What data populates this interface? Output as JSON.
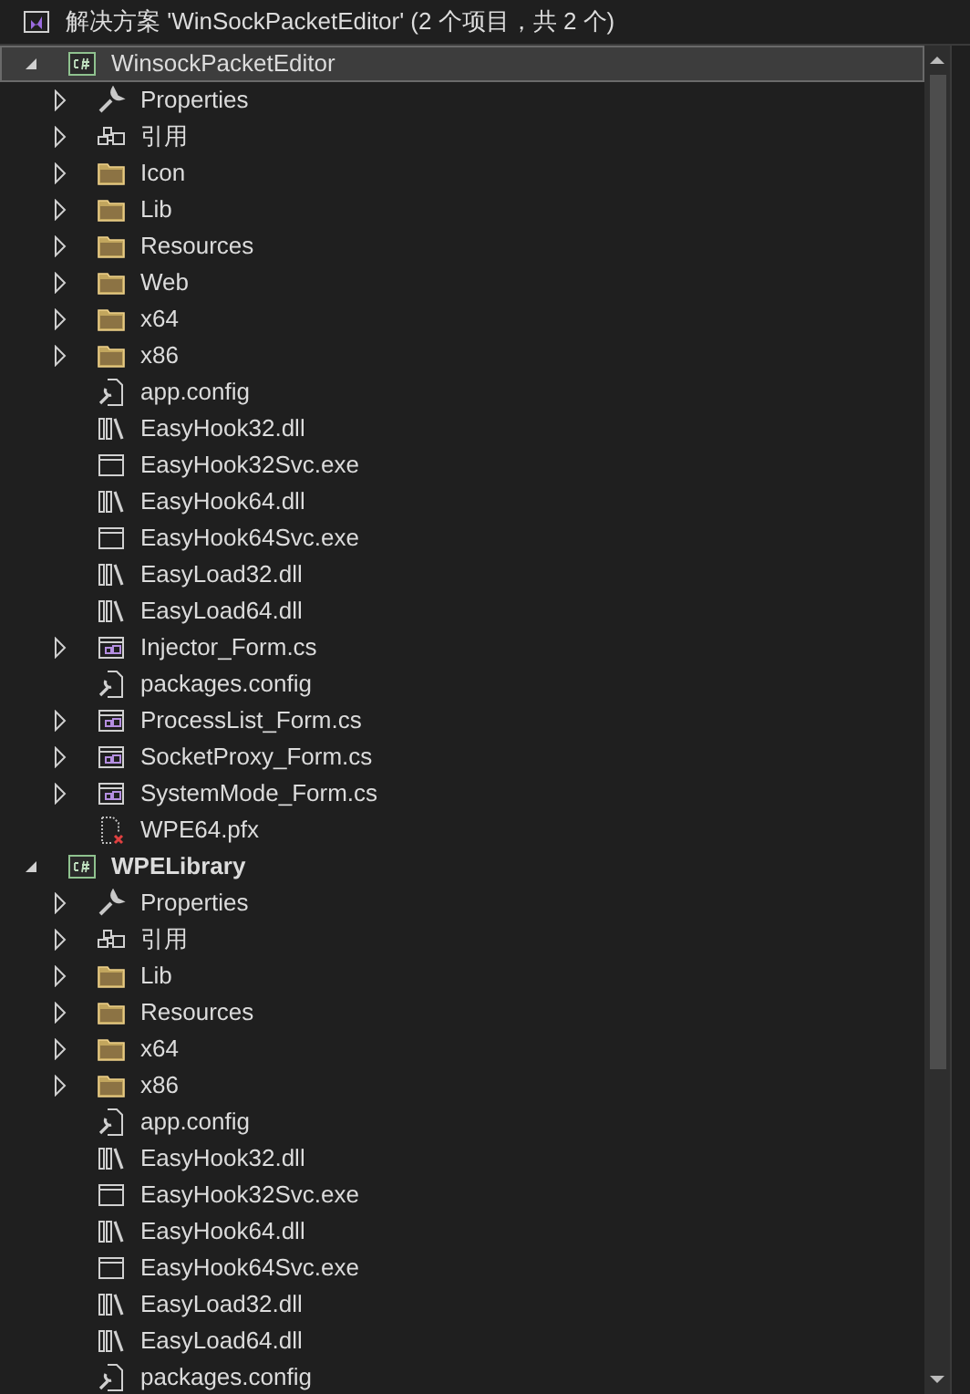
{
  "solution": {
    "title": "解决方案 'WinSockPacketEditor' (2 个项目，共 2 个)"
  },
  "projects": [
    {
      "name": "WinsockPacketEditor",
      "kind": "project",
      "expanded": true,
      "selected": true,
      "startup": false,
      "children": [
        {
          "name": "Properties",
          "kind": "properties",
          "expanded": false,
          "selected": false
        },
        {
          "name": "引用",
          "kind": "references",
          "expanded": false,
          "selected": false
        },
        {
          "name": "Icon",
          "kind": "folder",
          "expanded": false,
          "selected": false
        },
        {
          "name": "Lib",
          "kind": "folder",
          "expanded": false,
          "selected": false
        },
        {
          "name": "Resources",
          "kind": "folder",
          "expanded": false,
          "selected": false
        },
        {
          "name": "Web",
          "kind": "folder",
          "expanded": false,
          "selected": false
        },
        {
          "name": "x64",
          "kind": "folder",
          "expanded": false,
          "selected": false
        },
        {
          "name": "x86",
          "kind": "folder",
          "expanded": false,
          "selected": false
        },
        {
          "name": "app.config",
          "kind": "config",
          "selected": false
        },
        {
          "name": "EasyHook32.dll",
          "kind": "dll",
          "selected": false
        },
        {
          "name": "EasyHook32Svc.exe",
          "kind": "exe",
          "selected": false
        },
        {
          "name": "EasyHook64.dll",
          "kind": "dll",
          "selected": false
        },
        {
          "name": "EasyHook64Svc.exe",
          "kind": "exe",
          "selected": false
        },
        {
          "name": "EasyLoad32.dll",
          "kind": "dll",
          "selected": false
        },
        {
          "name": "EasyLoad64.dll",
          "kind": "dll",
          "selected": false
        },
        {
          "name": "Injector_Form.cs",
          "kind": "form",
          "expanded": false,
          "selected": false
        },
        {
          "name": "packages.config",
          "kind": "config",
          "selected": false
        },
        {
          "name": "ProcessList_Form.cs",
          "kind": "form",
          "expanded": false,
          "selected": false
        },
        {
          "name": "SocketProxy_Form.cs",
          "kind": "form",
          "expanded": false,
          "selected": false
        },
        {
          "name": "SystemMode_Form.cs",
          "kind": "form",
          "expanded": false,
          "selected": false
        },
        {
          "name": "WPE64.pfx",
          "kind": "pfx",
          "selected": false
        }
      ]
    },
    {
      "name": "WPELibrary",
      "kind": "project",
      "expanded": true,
      "selected": false,
      "startup": true,
      "children": [
        {
          "name": "Properties",
          "kind": "properties",
          "expanded": false,
          "selected": false
        },
        {
          "name": "引用",
          "kind": "references",
          "expanded": false,
          "selected": false
        },
        {
          "name": "Lib",
          "kind": "folder",
          "expanded": false,
          "selected": false
        },
        {
          "name": "Resources",
          "kind": "folder",
          "expanded": false,
          "selected": false
        },
        {
          "name": "x64",
          "kind": "folder",
          "expanded": false,
          "selected": false
        },
        {
          "name": "x86",
          "kind": "folder",
          "expanded": false,
          "selected": false
        },
        {
          "name": "app.config",
          "kind": "config",
          "selected": false
        },
        {
          "name": "EasyHook32.dll",
          "kind": "dll",
          "selected": false
        },
        {
          "name": "EasyHook32Svc.exe",
          "kind": "exe",
          "selected": false
        },
        {
          "name": "EasyHook64.dll",
          "kind": "dll",
          "selected": false
        },
        {
          "name": "EasyHook64Svc.exe",
          "kind": "exe",
          "selected": false
        },
        {
          "name": "EasyLoad32.dll",
          "kind": "dll",
          "selected": false
        },
        {
          "name": "EasyLoad64.dll",
          "kind": "dll",
          "selected": false
        },
        {
          "name": "packages.config",
          "kind": "config",
          "selected": false
        }
      ]
    }
  ]
}
